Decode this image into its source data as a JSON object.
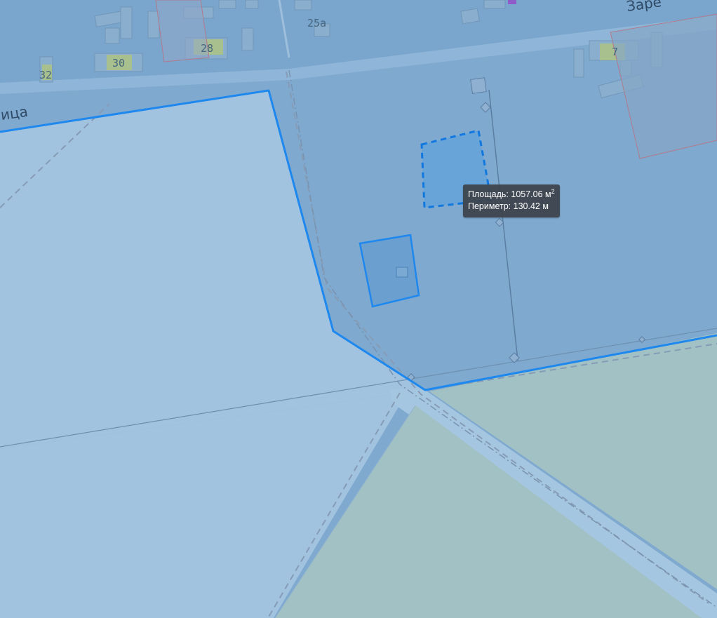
{
  "map": {
    "house_numbers": [
      "32",
      "30",
      "28",
      "25а",
      "7"
    ],
    "street_labels": [
      "ица",
      "Заре"
    ],
    "colors": {
      "background": "#7fa9cf",
      "outline": "#1e88ee",
      "light_parcel": "#a1c3df",
      "green_zone": "#a2c1c4"
    }
  },
  "measurement": {
    "area_label": "Площадь:",
    "area_value": "1057.06",
    "area_unit": "м",
    "area_exponent": "2",
    "perimeter_label": "Периметр:",
    "perimeter_value": "130.42",
    "perimeter_unit": "м"
  }
}
